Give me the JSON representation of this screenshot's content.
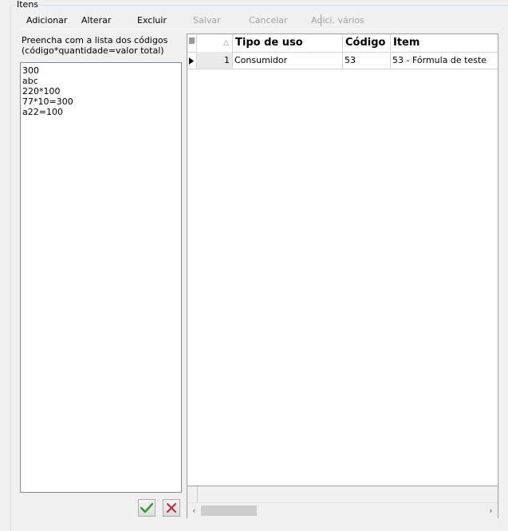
{
  "group": {
    "title": "Itens"
  },
  "toolbar": {
    "add_label": "Adicionar",
    "edit_label": "Alterar",
    "delete_label": "Excluir",
    "save_label": "Salvar",
    "cancel_label": "Cancelar",
    "add_many_label": "Adici. vários"
  },
  "codes_panel": {
    "instruction_line1": "Preencha com a lista dos códigos",
    "instruction_line2": "(código*quantidade=valor total)",
    "lines": [
      "300",
      "abc",
      "220*100",
      "77*10=300",
      "a22=100"
    ]
  },
  "grid": {
    "columns": {
      "tipo_de_uso": "Tipo de uso",
      "codigo": "Código",
      "item": "Item"
    },
    "rows": [
      {
        "num": "1",
        "tipo_de_uso": "Consumidor",
        "codigo": "53",
        "item": "53 - Fórmula de teste"
      }
    ]
  },
  "colors": {
    "confirm": "#2e9a2e",
    "cancel": "#c0282d"
  },
  "icons": [
    "column-chooser-icon",
    "sort-ascending-icon",
    "row-indicator-icon",
    "confirm-check-icon",
    "cancel-x-icon",
    "scroll-left-icon",
    "scroll-right-icon"
  ]
}
